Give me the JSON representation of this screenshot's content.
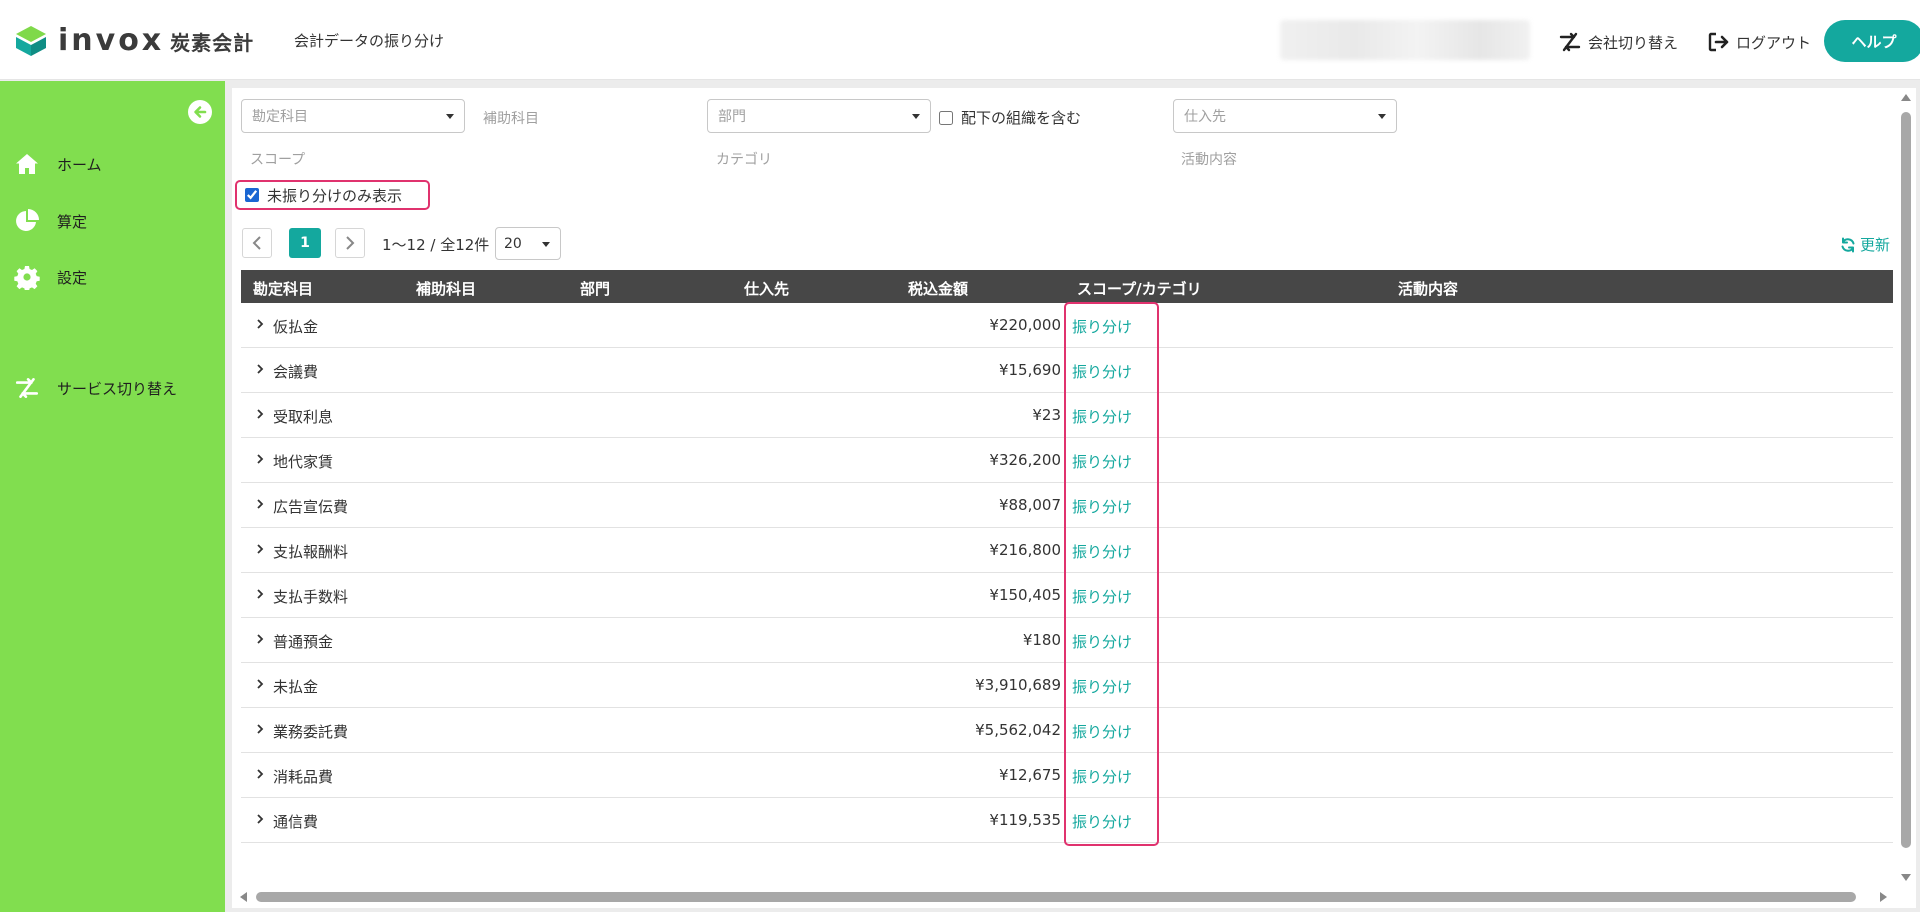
{
  "header": {
    "logo_word": "invox",
    "logo_sub": "炭素会計",
    "page_title": "会計データの振り分け",
    "switch_company": "会社切り替え",
    "logout": "ログアウト",
    "help": "ヘルプ"
  },
  "sidebar": {
    "items": [
      {
        "label": "ホーム",
        "icon": "home-icon"
      },
      {
        "label": "算定",
        "icon": "pie-chart-icon"
      },
      {
        "label": "設定",
        "icon": "gear-icon"
      },
      {
        "label": "サービス切り替え",
        "icon": "switch-icon"
      }
    ]
  },
  "filters": {
    "kamoku_placeholder": "勘定科目",
    "hojo_label": "補助科目",
    "bumon_placeholder": "部門",
    "include_sub_orgs": "配下の組織を含む",
    "shiire_placeholder": "仕入先",
    "scope_label": "スコープ",
    "category_label": "カテゴリ",
    "activity_label": "活動内容",
    "unassigned_only": "未振り分けのみ表示"
  },
  "pager": {
    "current": "1",
    "info": "1〜12 / 全12件",
    "page_size": "20",
    "refresh": "更新"
  },
  "table": {
    "headers": [
      "勘定科目",
      "補助科目",
      "部門",
      "仕入先",
      "税込金額",
      "スコープ/カテゴリ",
      "活動内容"
    ],
    "assign_label": "振り分け",
    "rows": [
      {
        "account": "仮払金",
        "amount": "¥220,000"
      },
      {
        "account": "会議費",
        "amount": "¥15,690"
      },
      {
        "account": "受取利息",
        "amount": "¥23"
      },
      {
        "account": "地代家賃",
        "amount": "¥326,200"
      },
      {
        "account": "広告宣伝費",
        "amount": "¥88,007"
      },
      {
        "account": "支払報酬料",
        "amount": "¥216,800"
      },
      {
        "account": "支払手数料",
        "amount": "¥150,405"
      },
      {
        "account": "普通預金",
        "amount": "¥180"
      },
      {
        "account": "未払金",
        "amount": "¥3,910,689"
      },
      {
        "account": "業務委託費",
        "amount": "¥5,562,042"
      },
      {
        "account": "消耗品費",
        "amount": "¥12,675"
      },
      {
        "account": "通信費",
        "amount": "¥119,535"
      }
    ]
  },
  "colors": {
    "sidebar": "#81de4f",
    "accent": "#14a89e",
    "highlight": "#e0326e",
    "table_header": "#474747"
  }
}
